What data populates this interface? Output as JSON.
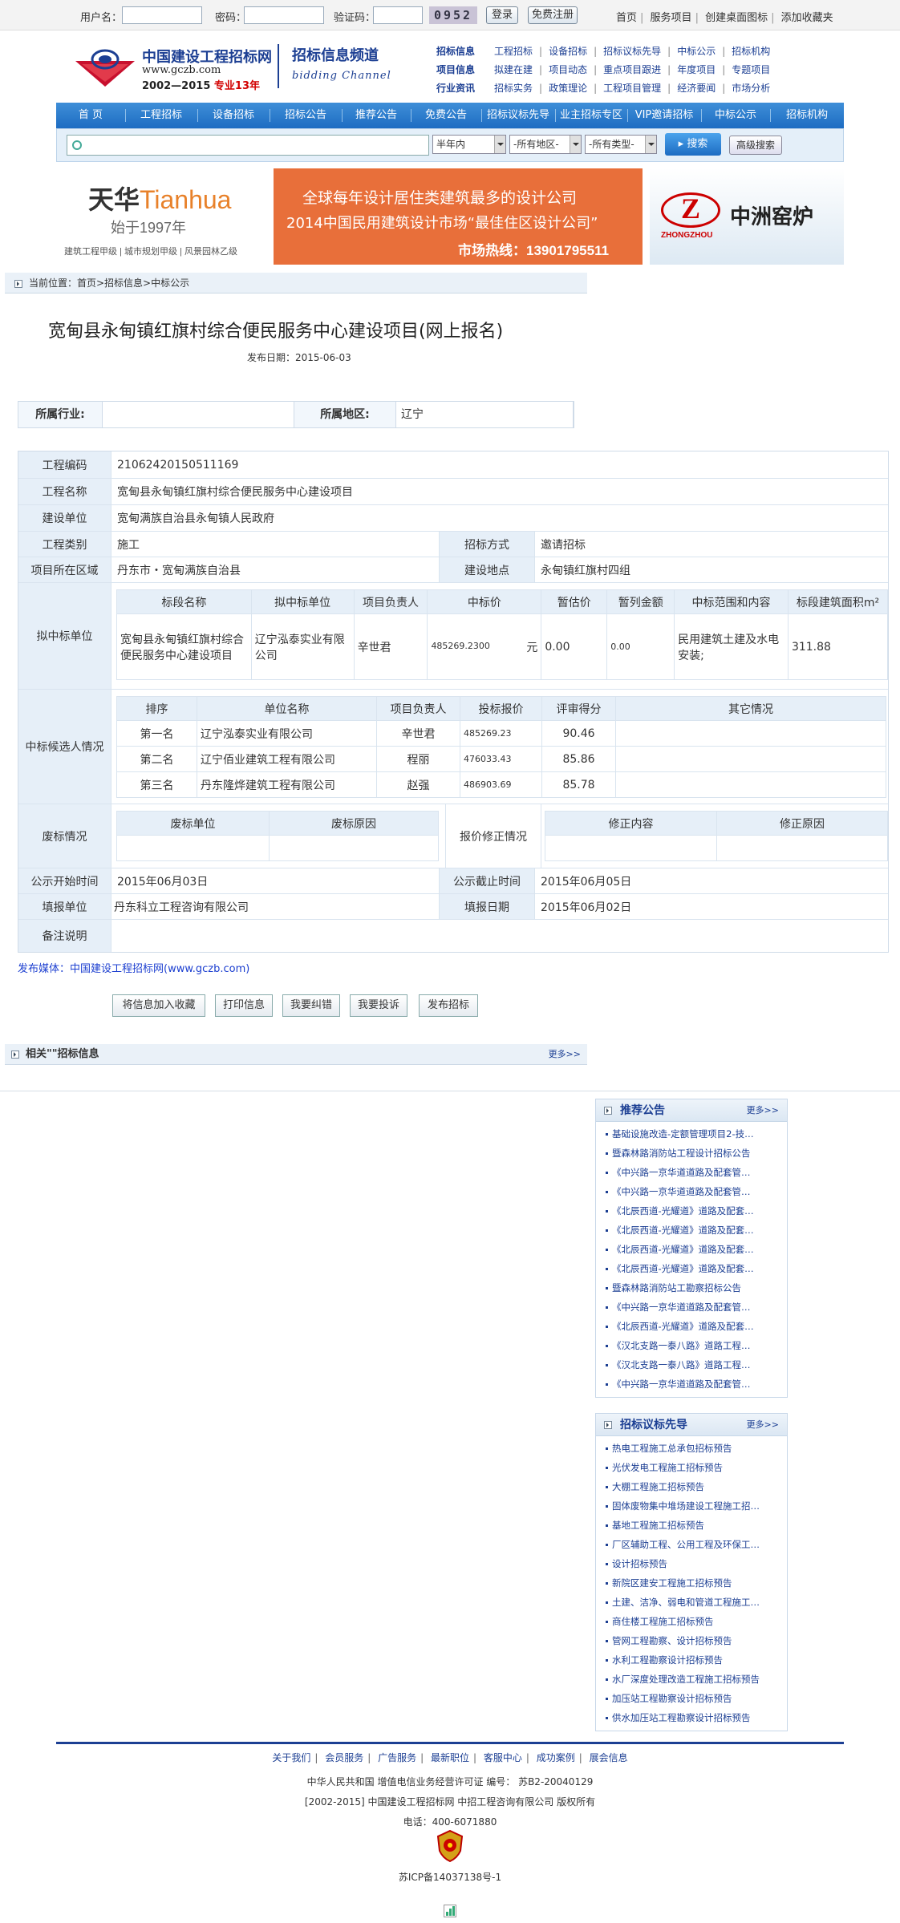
{
  "topbar": {
    "username_label": "用户名：",
    "password_label": "密码：",
    "captcha_label": "验证码：",
    "captcha_code": "0952",
    "login_button": "登录",
    "register_button": "免费注册",
    "links": [
      "首页",
      "服务项目",
      "创建桌面图标",
      "添加收藏夹"
    ]
  },
  "logo": {
    "name": "中国建设工程招标网",
    "url": "www.gczb.com",
    "years": "2002—2015",
    "tag": "专业13年"
  },
  "channel": {
    "title": "招标信息频道",
    "subtitle": "bidding Channel"
  },
  "category_nav": [
    {
      "cat": "招标信息",
      "items": [
        "工程招标",
        "设备招标",
        "招标议标先导",
        "中标公示",
        "招标机构"
      ]
    },
    {
      "cat": "项目信息",
      "items": [
        "拟建在建",
        "项目动态",
        "重点项目跟进",
        "年度项目",
        "专题项目"
      ]
    },
    {
      "cat": "行业资讯",
      "items": [
        "招标实务",
        "政策理论",
        "工程项目管理",
        "经济要闻",
        "市场分析"
      ]
    }
  ],
  "main_nav": [
    "首 页",
    "工程招标",
    "设备招标",
    "招标公告",
    "推荐公告",
    "免费公告",
    "招标议标先导",
    "业主招标专区",
    "VIP邀请招标",
    "中标公示",
    "招标机构"
  ],
  "search": {
    "placeholder": "",
    "time_select": "半年内",
    "region_select": "-所有地区-",
    "type_select": "-所有类型-",
    "search_button": "搜索",
    "advanced_button": "高级搜索"
  },
  "banners": {
    "tianhua_cn": "天华",
    "tianhua_en": "Tianhua",
    "tianhua_since": "始于1997年",
    "tianhua_footer": "建筑工程甲级 | 城市规划甲级 | 风景园林乙级",
    "orange_line1": "全球每年设计居住类建筑最多的设计公司",
    "orange_line2": "2014中国民用建筑设计市场“最佳住区设计公司”",
    "orange_line3": "市场热线：13901795511",
    "zz_en": "ZHONGZHOU",
    "zz_cn": "中洲窑炉"
  },
  "breadcrumb": "当前位置：首页>招标信息>中标公示",
  "page": {
    "title": "宽甸县永甸镇红旗村综合便民服务中心建设项目(网上报名)",
    "date": "发布日期：2015-06-03"
  },
  "meta": {
    "industry_label": "所属行业:",
    "industry_value": "",
    "region_label": "所属地区:",
    "region_value": "辽宁"
  },
  "detail": {
    "code_label": "工程编码",
    "code": "21062420150511169",
    "name_label": "工程名称",
    "name": "宽甸县永甸镇红旗村综合便民服务中心建设项目",
    "owner_label": "建设单位",
    "owner": "宽甸满族自治县永甸镇人民政府",
    "category_label": "工程类别",
    "category": "施工",
    "method_label": "招标方式",
    "method": "邀请招标",
    "area_label": "项目所在区域",
    "area": "丹东市・宽甸满族自治县",
    "site_label": "建设地点",
    "site": "永甸镇红旗村四组",
    "winner_label": "拟中标单位",
    "winner_headers": [
      "标段名称",
      "拟中标单位",
      "项目负责人",
      "中标价",
      "暂估价",
      "暂列金额",
      "中标范围和内容",
      "标段建筑面积m²"
    ],
    "winner_row": {
      "section": "宽甸县永甸镇红旗村综合便民服务中心建设项目",
      "company": "辽宁泓泰实业有限公司",
      "manager": "辛世君",
      "price": "485269.2300",
      "unit": "元",
      "estimate": "0.00",
      "provisional": "0.00",
      "scope": "民用建筑土建及水电安装;",
      "area": "311.88"
    },
    "candidates_label": "中标候选人情况",
    "candidate_headers": [
      "排序",
      "单位名称",
      "项目负责人",
      "投标报价",
      "评审得分",
      "其它情况"
    ],
    "candidates": [
      {
        "rank": "第一名",
        "company": "辽宁泓泰实业有限公司",
        "manager": "辛世君",
        "bid": "485269.23",
        "score": "90.46",
        "other": ""
      },
      {
        "rank": "第二名",
        "company": "辽宁佰业建筑工程有限公司",
        "manager": "程丽",
        "bid": "476033.43",
        "score": "85.86",
        "other": ""
      },
      {
        "rank": "第三名",
        "company": "丹东隆烨建筑工程有限公司",
        "manager": "赵强",
        "bid": "486903.69",
        "score": "85.78",
        "other": ""
      }
    ],
    "void_label": "废标情况",
    "void_headers": [
      "废标单位",
      "废标原因"
    ],
    "revise_label": "报价修正情况",
    "revise_headers": [
      "修正内容",
      "修正原因"
    ],
    "start_label": "公示开始时间",
    "start": "2015年06月03日",
    "end_label": "公示截止时间",
    "end": "2015年06月05日",
    "filler_label": "填报单位",
    "filler": "丹东科立工程咨询有限公司",
    "fill_date_label": "填报日期",
    "fill_date": "2015年06月02日",
    "remark_label": "备注说明",
    "remark": ""
  },
  "media": "发布媒体：中国建设工程招标网(www.gczb.com)",
  "actions": [
    "将信息加入收藏",
    "打印信息",
    "我要纠错",
    "我要投诉",
    "发布招标"
  ],
  "related": {
    "title": "相关\"\"招标信息",
    "more": "更多>>"
  },
  "recommend": {
    "title": "推荐公告",
    "more": "更多>>",
    "items": [
      "基础设施改造-定额管理项目2-技…",
      "暨森林路消防站工程设计招标公告",
      "《中兴路一京华道道路及配套管…",
      "《中兴路一京华道道路及配套管…",
      "《北辰西道-光耀道》道路及配套…",
      "《北辰西道-光耀道》道路及配套…",
      "《北辰西道-光耀道》道路及配套…",
      "《北辰西道-光耀道》道路及配套…",
      "暨森林路消防站工勘察招标公告",
      "《中兴路一京华道道路及配套管…",
      "《北辰西道-光耀道》道路及配套…",
      "《汉北支路一泰八路》道路工程…",
      "《汉北支路一泰八路》道路工程…",
      "《中兴路一京华道道路及配套管…"
    ]
  },
  "pioneer": {
    "title": "招标议标先导",
    "more": "更多>>",
    "items": [
      "热电工程施工总承包招标预告",
      "光伏发电工程施工招标预告",
      "大棚工程施工招标预告",
      "固体废物集中堆场建设工程施工招…",
      "基地工程施工招标预告",
      "厂区辅助工程、公用工程及环保工…",
      "设计招标预告",
      "新院区建安工程施工招标预告",
      "土建、洁净、弱电和管道工程施工…",
      "商住楼工程施工招标预告",
      "管网工程勘察、设计招标预告",
      "水利工程勘察设计招标预告",
      "水厂深度处理改造工程施工招标预告",
      "加压站工程勘察设计招标预告",
      "供水加压站工程勘察设计招标预告"
    ]
  },
  "footer": {
    "links": [
      "关于我们",
      "会员服务",
      "广告服务",
      "最新职位",
      "客服中心",
      "成功案例",
      "展会信息"
    ],
    "license": "中华人民共和国  增值电信业务经营许可证  编号： 苏B2-20040129",
    "copyright": "[2002-2015] 中国建设工程招标网  中招工程咨询有限公司  版权所有",
    "phone": "电话：400-6071880",
    "icp": "苏ICP备14037138号-1"
  }
}
